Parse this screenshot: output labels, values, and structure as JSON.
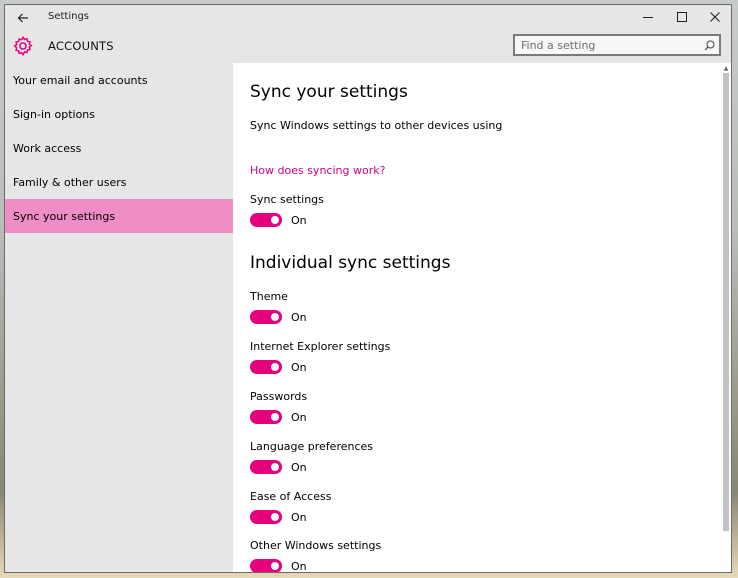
{
  "window": {
    "title": "Settings"
  },
  "header": {
    "title": "ACCOUNTS"
  },
  "search": {
    "placeholder": "Find a setting"
  },
  "sidebar": {
    "items": [
      {
        "label": "Your email and accounts"
      },
      {
        "label": "Sign-in options"
      },
      {
        "label": "Work access"
      },
      {
        "label": "Family & other users"
      },
      {
        "label": "Sync your settings",
        "selected": true
      }
    ]
  },
  "main": {
    "heading": "Sync your settings",
    "description": "Sync Windows settings to other devices using",
    "link": "How does syncing work?",
    "sync": {
      "label": "Sync settings",
      "state": "On"
    },
    "individual_heading": "Individual sync settings",
    "settings": [
      {
        "label": "Theme",
        "state": "On"
      },
      {
        "label": "Internet Explorer settings",
        "state": "On"
      },
      {
        "label": "Passwords",
        "state": "On"
      },
      {
        "label": "Language preferences",
        "state": "On"
      },
      {
        "label": "Ease of Access",
        "state": "On"
      },
      {
        "label": "Other Windows settings",
        "state": "On"
      }
    ]
  },
  "colors": {
    "accent": "#e5007d",
    "selected_nav": "#ef8dc6",
    "link": "#d6007e",
    "chrome": "#e6e6e6"
  },
  "icons": [
    "back-arrow-icon",
    "minimize-icon",
    "maximize-icon",
    "close-icon",
    "gear-icon",
    "search-icon"
  ]
}
